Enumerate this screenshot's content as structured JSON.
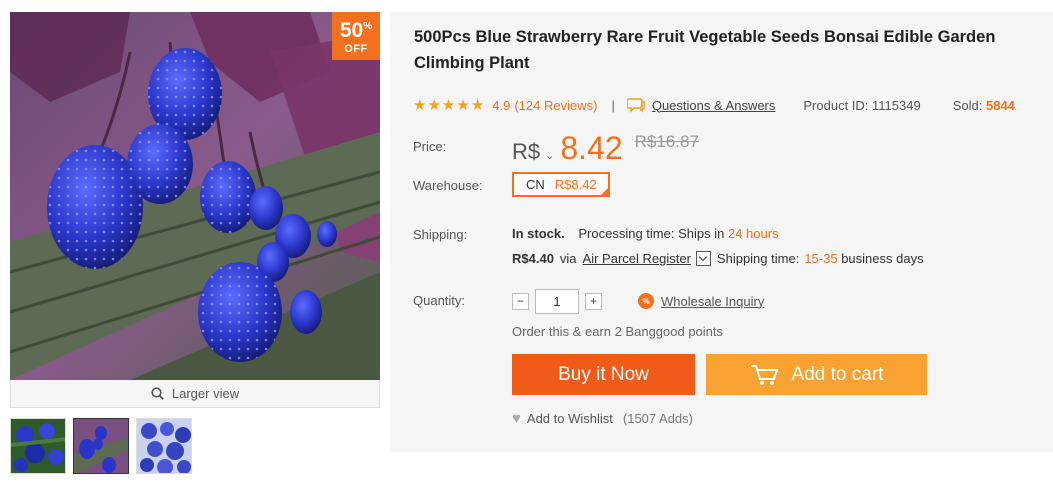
{
  "product": {
    "title": "500Pcs Blue Strawberry Rare Fruit Vegetable Seeds Bonsai Edible Garden Climbing Plant",
    "discount_badge": {
      "percent": "50",
      "percent_sign": "%",
      "off_label": "OFF"
    },
    "larger_view_label": "Larger view",
    "rating_stars": 5,
    "rating": "4.9",
    "reviews": "(124 Reviews)",
    "separator": "|",
    "qa_label": "Questions & Answers",
    "product_id": "Product ID: 1115349",
    "sold_label": "Sold:",
    "sold_count": "5844"
  },
  "price": {
    "label": "Price:",
    "currency": "R$",
    "current": "8.42",
    "old": "R$16.87"
  },
  "warehouse": {
    "label": "Warehouse:",
    "code": "CN",
    "price": "R$8.42"
  },
  "shipping": {
    "label": "Shipping:",
    "stock": "In stock.",
    "processing_label": "Processing time:",
    "processing_prefix": "Ships in",
    "processing_value": "24 hours",
    "cost": "R$4.40",
    "via": "via",
    "method": "Air Parcel Register",
    "time_label": "Shipping time:",
    "time_value": "15-35",
    "time_suffix": "business days"
  },
  "quantity": {
    "label": "Quantity:",
    "minus": "−",
    "value": "1",
    "plus": "+",
    "wholesale_icon": "%",
    "wholesale_label": "Wholesale Inquiry"
  },
  "points_text": "Order this & earn 2 Banggood points",
  "buttons": {
    "buy_now": "Buy it Now",
    "add_to_cart": "Add to cart"
  },
  "wishlist": {
    "label": "Add to Wishlist",
    "count": "(1507 Adds)"
  },
  "colors": {
    "accent": "#f3701f",
    "buy_button": "#f05b1a",
    "cart_button": "#f7a233",
    "panel_bg": "#f5f5f5"
  }
}
